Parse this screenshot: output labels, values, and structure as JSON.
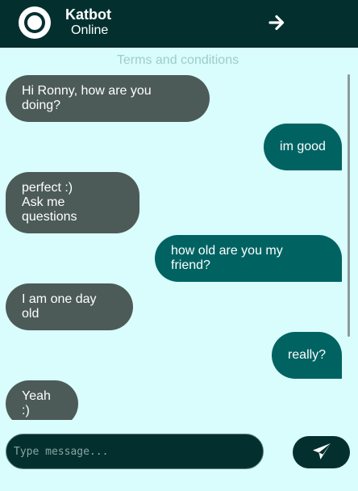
{
  "header": {
    "bot_name": "Katbot",
    "status": "Online",
    "exit_icon": "arrow-right-icon",
    "avatar_icon": "bot-avatar-icon"
  },
  "terms_link": "Terms and conditions",
  "messages": [
    {
      "sender": "bot",
      "text": "Hi Ronny, how are you doing?"
    },
    {
      "sender": "user",
      "text": "im good"
    },
    {
      "sender": "bot",
      "text": "perfect :)\nAsk me questions"
    },
    {
      "sender": "user",
      "text": "how old are you my friend?"
    },
    {
      "sender": "bot",
      "text": "I am one day old"
    },
    {
      "sender": "user",
      "text": "really?"
    },
    {
      "sender": "bot",
      "text": "Yeah :)"
    }
  ],
  "composer": {
    "placeholder": "Type message...",
    "value": "",
    "send_icon": "send-icon"
  },
  "colors": {
    "header_bg": "#03302f",
    "page_bg": "#d9fcfc",
    "bot_bubble": "#4c5b58",
    "user_bubble": "#006362"
  }
}
